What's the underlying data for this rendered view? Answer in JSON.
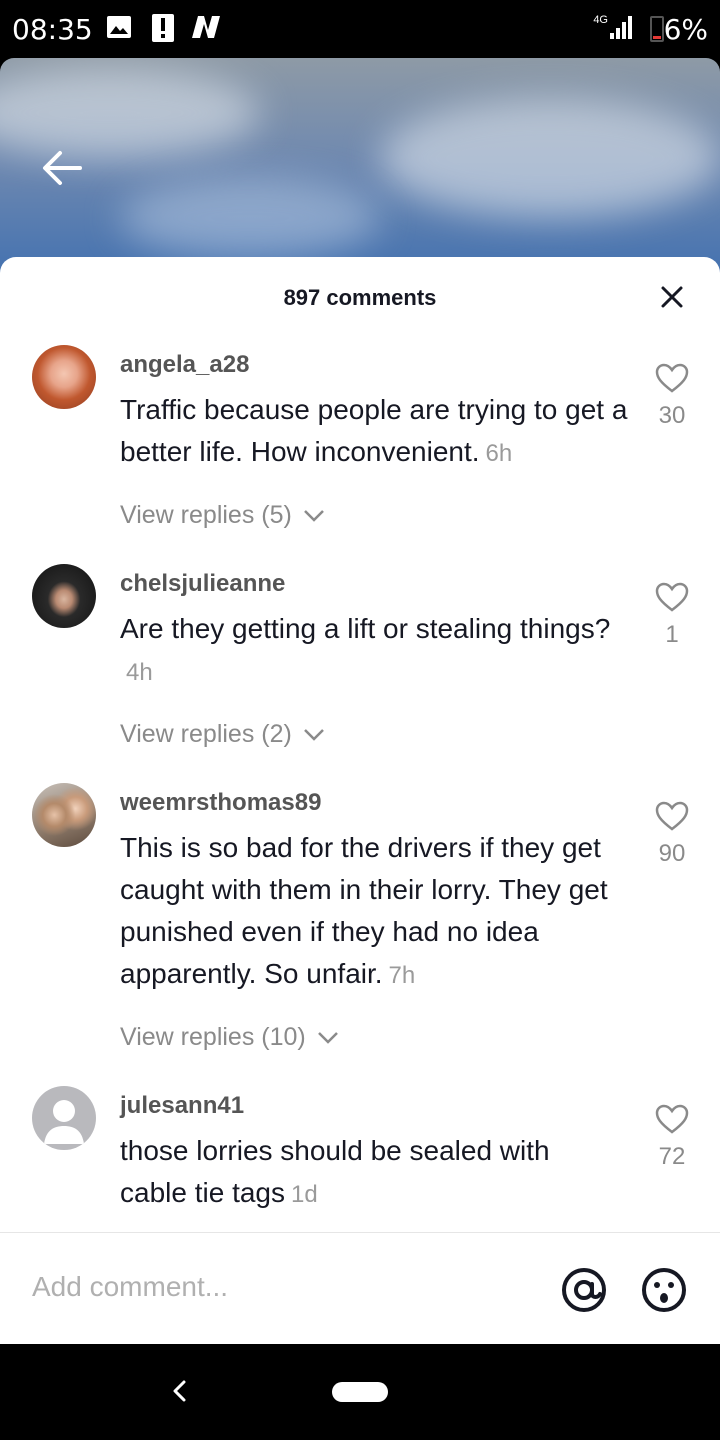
{
  "status_bar": {
    "time": "08:35",
    "network": "4G",
    "battery": "6%",
    "icons": [
      "image-icon",
      "alert-icon",
      "news-icon",
      "signal-icon",
      "battery-icon"
    ]
  },
  "header": {
    "back_icon": "back-arrow-icon"
  },
  "sheet": {
    "title": "897 comments",
    "close_icon": "close-icon"
  },
  "comments": [
    {
      "username": "angela_a28",
      "text": "Traffic because people are trying to get a better life. How inconvenient.",
      "time": "6h",
      "likes": "30",
      "replies": "View replies (5)"
    },
    {
      "username": "chelsjulieanne",
      "text": "Are they getting a lift or stealing things?",
      "time": "4h",
      "likes": "1",
      "replies": "View replies (2)"
    },
    {
      "username": "weemrsthomas89",
      "text": "This is so bad for the drivers if they get caught with them in their lorry. They get punished even if they had no idea apparently. So unfair.",
      "time": "7h",
      "likes": "90",
      "replies": "View replies (10)"
    },
    {
      "username": "julesann41",
      "text": "those lorries should be sealed with cable tie tags",
      "time": "1d",
      "likes": "72"
    }
  ],
  "input": {
    "placeholder": "Add comment...",
    "icons": [
      "at-mention-icon",
      "emoji-icon"
    ]
  },
  "colors": {
    "text_primary": "#161823",
    "text_secondary": "#8a8a8a",
    "battery_low": "#e53935"
  }
}
